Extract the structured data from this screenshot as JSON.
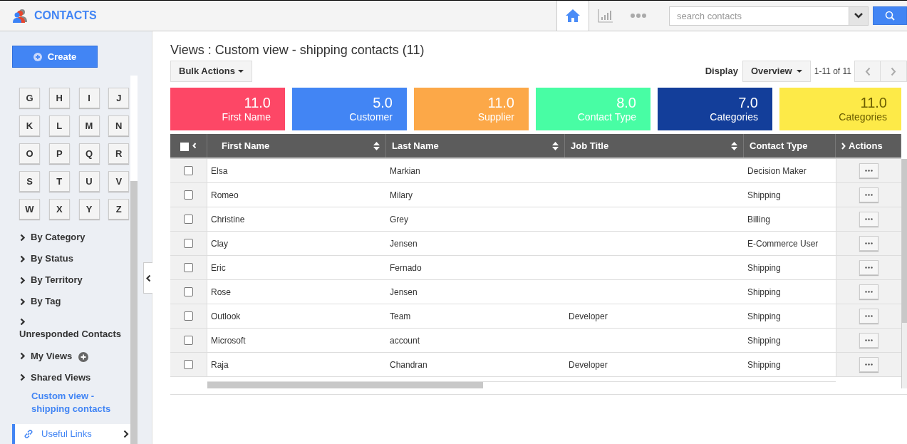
{
  "app": {
    "title": "CONTACTS"
  },
  "nav_tabs": [
    {
      "kind": "home",
      "selected": true
    },
    {
      "kind": "chart",
      "selected": false
    },
    {
      "kind": "more",
      "selected": false
    }
  ],
  "search": {
    "placeholder": "search contacts"
  },
  "sidebar": {
    "create_label": "Create",
    "letters": [
      "G",
      "H",
      "I",
      "J",
      "K",
      "L",
      "M",
      "N",
      "O",
      "P",
      "Q",
      "R",
      "S",
      "T",
      "U",
      "V",
      "W",
      "X",
      "Y",
      "Z"
    ],
    "sections": [
      {
        "label": "By Category",
        "wrapped": false,
        "addable": false
      },
      {
        "label": "By Status",
        "wrapped": false,
        "addable": false
      },
      {
        "label": "By Territory",
        "wrapped": false,
        "addable": false
      },
      {
        "label": "By Tag",
        "wrapped": false,
        "addable": false
      },
      {
        "label": "Unresponded Contacts",
        "wrapped": true,
        "addable": false
      },
      {
        "label": "My Views",
        "wrapped": false,
        "addable": true
      },
      {
        "label": "Shared Views",
        "wrapped": false,
        "addable": false
      }
    ],
    "current_view": "Custom view - shipping contacts",
    "useful_links": "Useful Links"
  },
  "page_title": "Views : Custom view - shipping contacts (11)",
  "bulk_actions": "Bulk Actions",
  "display": {
    "label": "Display",
    "value": "Overview",
    "range": "1-11 of 11"
  },
  "stats": [
    {
      "value": "11.0",
      "label": "First Name",
      "color": "#fd4766"
    },
    {
      "value": "5.0",
      "label": "Customer",
      "color": "#4285f4"
    },
    {
      "value": "11.0",
      "label": "Supplier",
      "color": "#fca848"
    },
    {
      "value": "8.0",
      "label": "Contact Type",
      "color": "#48fda4"
    },
    {
      "value": "7.0",
      "label": "Categories",
      "color": "#133e9a"
    },
    {
      "value": "11.0",
      "label": "Categories",
      "color": "#fdea48"
    }
  ],
  "table": {
    "select_all_checked": false,
    "columns": [
      {
        "label": "First Name",
        "sortable": true
      },
      {
        "label": "Last Name",
        "sortable": true
      },
      {
        "label": "Job Title",
        "sortable": true
      },
      {
        "label": "Contact Type",
        "sortable": false
      },
      {
        "label": "Actions",
        "sortable": false
      }
    ],
    "rows": [
      {
        "checked": false,
        "cells": [
          "Elsa",
          "Markian",
          "",
          "Decision Maker"
        ]
      },
      {
        "checked": false,
        "cells": [
          "Romeo",
          "Milary",
          "",
          "Shipping"
        ]
      },
      {
        "checked": false,
        "cells": [
          "Christine",
          "Grey",
          "",
          "Billing"
        ]
      },
      {
        "checked": false,
        "cells": [
          "Clay",
          "Jensen",
          "",
          "E-Commerce User"
        ]
      },
      {
        "checked": false,
        "cells": [
          "Eric",
          "Fernado",
          "",
          "Shipping"
        ]
      },
      {
        "checked": false,
        "cells": [
          "Rose",
          "Jensen",
          "",
          "Shipping"
        ]
      },
      {
        "checked": false,
        "cells": [
          "Outlook",
          "Team",
          "Developer",
          "Shipping"
        ]
      },
      {
        "checked": false,
        "cells": [
          "Microsoft",
          "account",
          "",
          "Shipping"
        ]
      },
      {
        "checked": false,
        "cells": [
          "Raja",
          "Chandran",
          "Developer",
          "Shipping"
        ]
      }
    ]
  }
}
